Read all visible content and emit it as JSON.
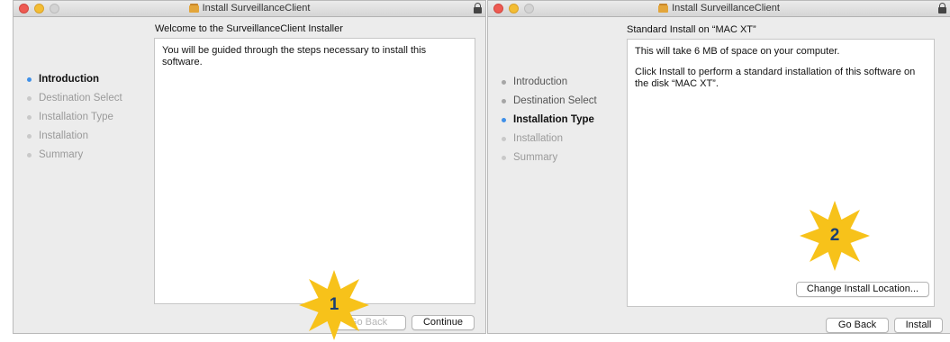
{
  "windows": [
    {
      "title": "Install SurveillanceClient",
      "heading": "Welcome to the SurveillanceClient Installer",
      "steps": [
        {
          "label": "Introduction",
          "state": "active"
        },
        {
          "label": "Destination Select",
          "state": "pending"
        },
        {
          "label": "Installation Type",
          "state": "pending"
        },
        {
          "label": "Installation",
          "state": "pending"
        },
        {
          "label": "Summary",
          "state": "pending"
        }
      ],
      "body": [
        "You will be guided through the steps necessary to install this software."
      ],
      "buttons": {
        "go_back": "Go Back",
        "continue": "Continue"
      }
    },
    {
      "title": "Install SurveillanceClient",
      "heading": "Standard Install on “MAC XT”",
      "steps": [
        {
          "label": "Introduction",
          "state": "done"
        },
        {
          "label": "Destination Select",
          "state": "done"
        },
        {
          "label": "Installation Type",
          "state": "active"
        },
        {
          "label": "Installation",
          "state": "pending"
        },
        {
          "label": "Summary",
          "state": "pending"
        }
      ],
      "body": [
        "This will take 6 MB of space on your computer.",
        "Click Install to perform a standard installation of this software on the disk “MAC XT”."
      ],
      "buttons": {
        "change_location": "Change Install Location...",
        "go_back": "Go Back",
        "install": "Install"
      }
    }
  ],
  "callouts": [
    "1",
    "2"
  ],
  "colors": {
    "active_step": "#3f90e8",
    "callout_fill": "#f7c21a",
    "callout_text": "#1a3f73"
  }
}
